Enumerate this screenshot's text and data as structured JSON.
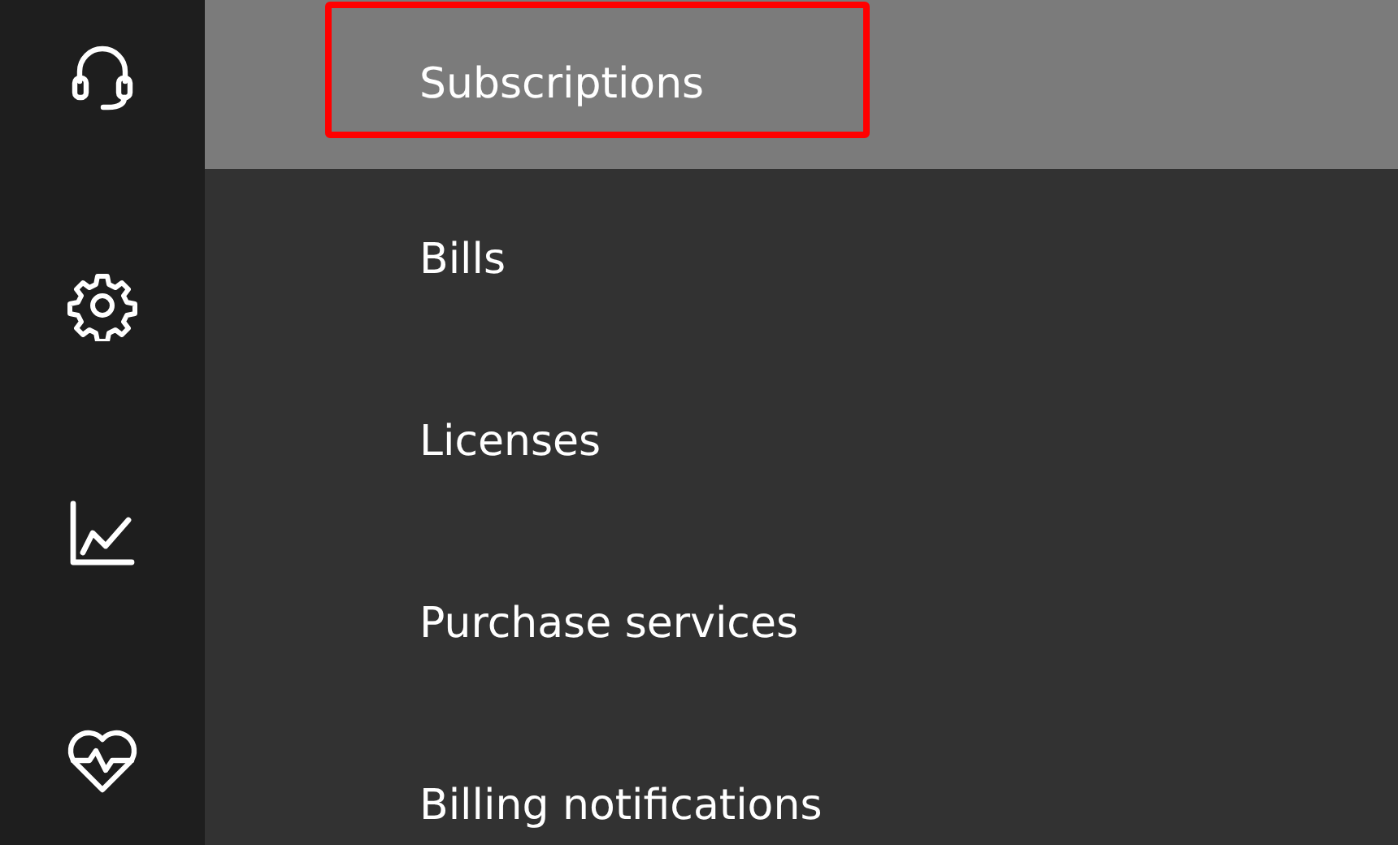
{
  "rail": {
    "icons": [
      {
        "kind": "headset"
      },
      {
        "kind": "gear"
      },
      {
        "kind": "chart"
      },
      {
        "kind": "heart"
      }
    ]
  },
  "menu": {
    "items": [
      {
        "label": "Subscriptions",
        "selected": true,
        "highlighted": true
      },
      {
        "label": "Bills",
        "selected": false,
        "highlighted": false
      },
      {
        "label": "Licenses",
        "selected": false,
        "highlighted": false
      },
      {
        "label": "Purchase services",
        "selected": false,
        "highlighted": false
      },
      {
        "label": "Billing notifications",
        "selected": false,
        "highlighted": false
      }
    ]
  }
}
